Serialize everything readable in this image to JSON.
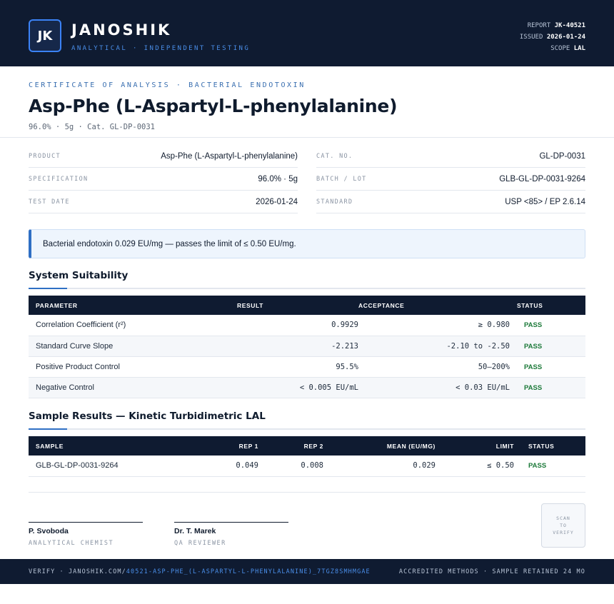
{
  "header": {
    "logo": "JK",
    "brand": "JANOSHIK",
    "tagline": "ANALYTICAL · INDEPENDENT TESTING",
    "report_label": "REPORT",
    "report_value": "JK-40521",
    "issued_label": "ISSUED",
    "issued_value": "2026-01-24",
    "scope_label": "SCOPE",
    "scope_value": "LAL"
  },
  "title_block": {
    "eyebrow": "CERTIFICATE OF ANALYSIS · BACTERIAL ENDOTOXIN",
    "title": "Asp-Phe (L-Aspartyl-L-phenylalanine)",
    "subline": "96.0% · 5g  ·  Cat. GL-DP-0031"
  },
  "info": {
    "left": [
      {
        "label": "PRODUCT",
        "value": "Asp-Phe (L-Aspartyl-L-phenylalanine)"
      },
      {
        "label": "SPECIFICATION",
        "value": "96.0% · 5g"
      },
      {
        "label": "TEST DATE",
        "value": "2026-01-24"
      }
    ],
    "right": [
      {
        "label": "CAT. NO.",
        "value": "GL-DP-0031"
      },
      {
        "label": "BATCH / LOT",
        "value": "GLB-GL-DP-0031-9264"
      },
      {
        "label": "STANDARD",
        "value": "USP <85> / EP 2.6.14"
      }
    ]
  },
  "callout": "Bacterial endotoxin 0.029 EU/mg — passes the limit of ≤ 0.50 EU/mg.",
  "suitability": {
    "title": "System Suitability",
    "headers": [
      "PARAMETER",
      "RESULT",
      "ACCEPTANCE",
      "STATUS"
    ],
    "rows": [
      {
        "parameter": "Correlation Coefficient (r²)",
        "result": "0.9929",
        "acceptance": "≥ 0.980",
        "status": "PASS"
      },
      {
        "parameter": "Standard Curve Slope",
        "result": "-2.213",
        "acceptance": "-2.10 to -2.50",
        "status": "PASS"
      },
      {
        "parameter": "Positive Product Control",
        "result": "95.5%",
        "acceptance": "50–200%",
        "status": "PASS"
      },
      {
        "parameter": "Negative Control",
        "result": "< 0.005 EU/mL",
        "acceptance": "< 0.03 EU/mL",
        "status": "PASS"
      }
    ]
  },
  "samples": {
    "title": "Sample Results — Kinetic Turbidimetric LAL",
    "headers": [
      "SAMPLE",
      "REP 1",
      "REP 2",
      "MEAN (EU/MG)",
      "LIMIT",
      "STATUS"
    ],
    "rows": [
      {
        "sample": "GLB-GL-DP-0031-9264",
        "rep1": "0.049",
        "rep2": "0.008",
        "mean": "0.029",
        "limit": "≤ 0.50",
        "status": "PASS"
      }
    ]
  },
  "signatures": [
    {
      "name": "P. Svoboda",
      "role": "ANALYTICAL CHEMIST"
    },
    {
      "name": "Dr. T. Marek",
      "role": "QA REVIEWER"
    }
  ],
  "qr": {
    "line1": "SCAN",
    "line2": "TO",
    "line3": "VERIFY"
  },
  "footer": {
    "verify_prefix": "VERIFY · JANOSHIK.COM/",
    "verify_url": "40521-ASP-PHE_(L-ASPARTYL-L-PHENYLALANINE)_7TGZ8SMHMGAE",
    "right": "ACCREDITED METHODS · SAMPLE RETAINED 24 MO"
  },
  "colors": {
    "navy": "#0f1b31",
    "accent": "#2f6fc4",
    "pass": "#1d7a3a"
  }
}
